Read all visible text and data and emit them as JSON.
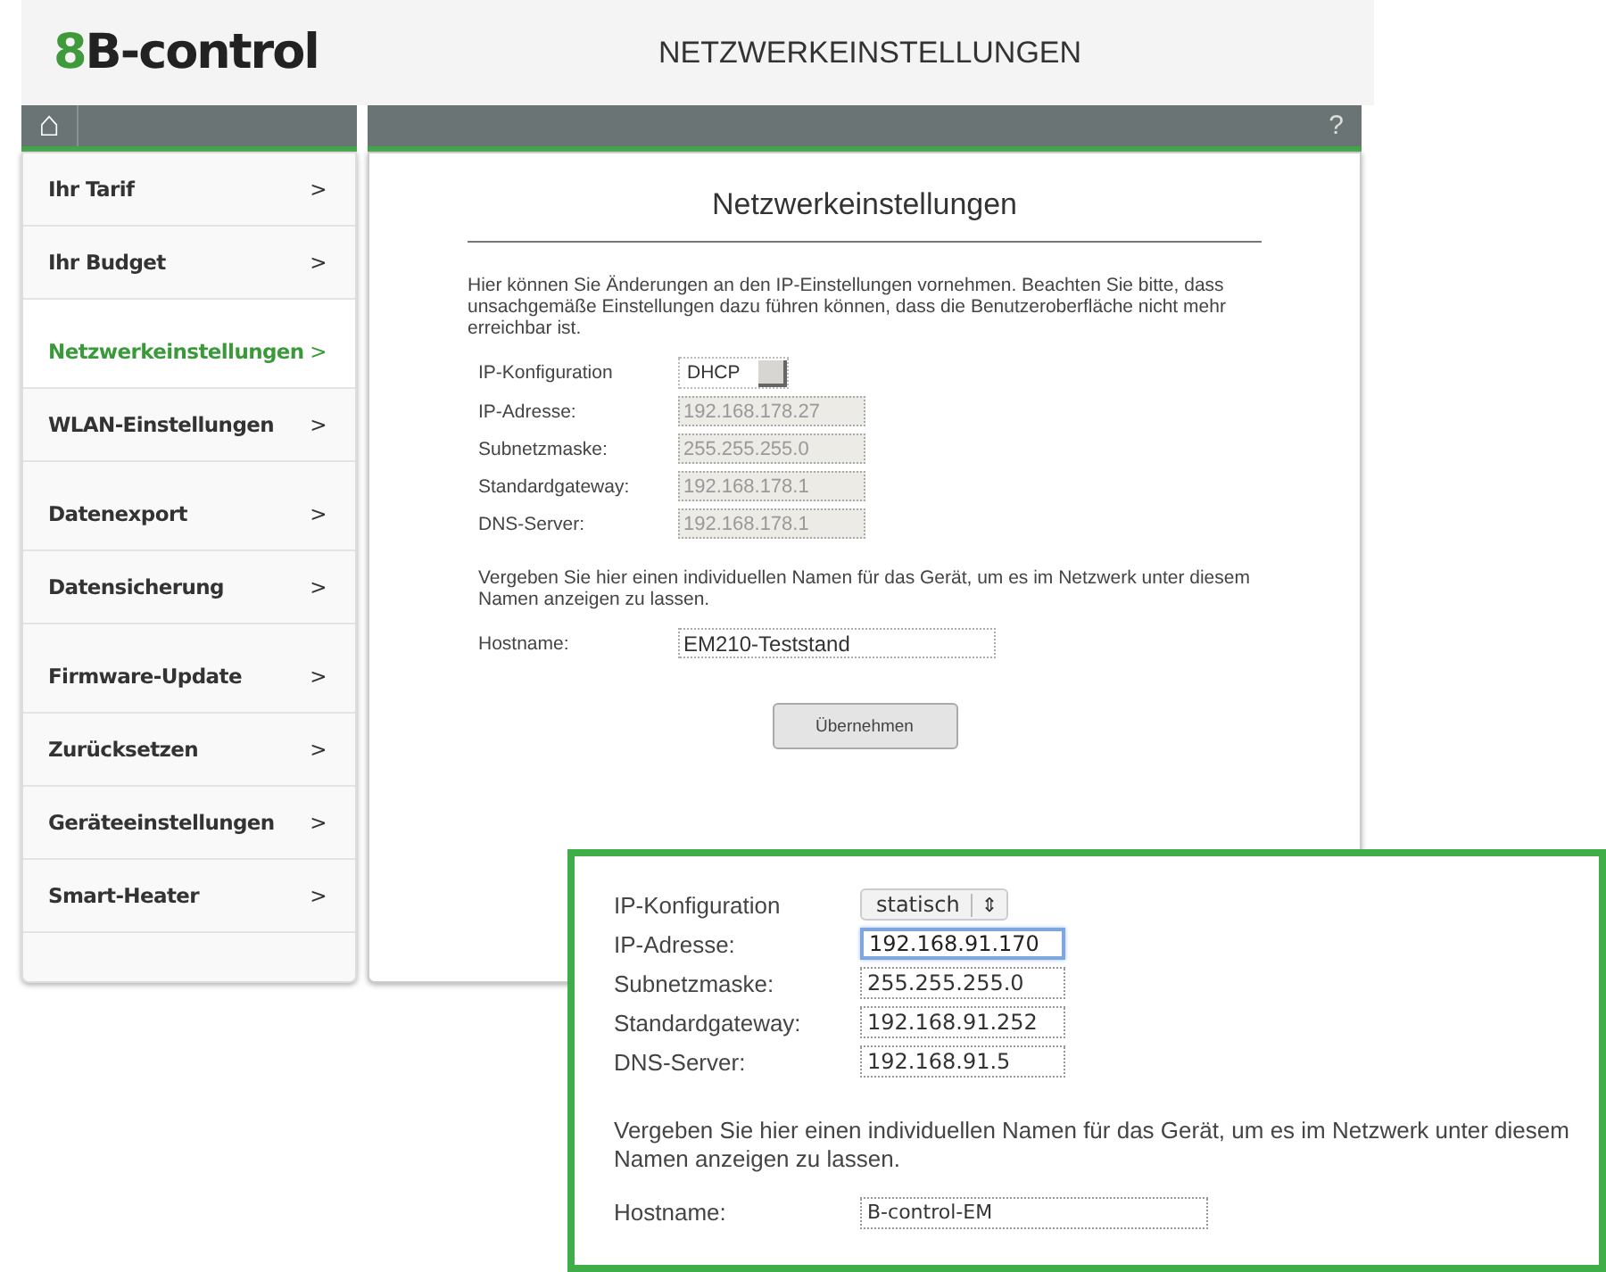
{
  "header": {
    "logo_mark": "8",
    "logo_text": "B-control",
    "title": "NETZWERKEINSTELLUNGEN"
  },
  "toolbar": {
    "home": "⌂",
    "help": "?"
  },
  "sidebar": {
    "items": [
      {
        "label": "Ihr Tarif",
        "selected": false
      },
      {
        "label": "Ihr Budget",
        "selected": false
      },
      {
        "label": "Netzwerkeinstellungen",
        "selected": true
      },
      {
        "label": "WLAN-Einstellungen",
        "selected": false
      },
      {
        "label": "Datenexport",
        "selected": false
      },
      {
        "label": "Datensicherung",
        "selected": false
      },
      {
        "label": "Firmware-Update",
        "selected": false
      },
      {
        "label": "Zurücksetzen",
        "selected": false
      },
      {
        "label": "Geräteeinstellungen",
        "selected": false
      },
      {
        "label": "Smart-Heater",
        "selected": false
      }
    ],
    "chevron": ">"
  },
  "main": {
    "heading": "Netzwerkeinstellungen",
    "intro": "Hier können Sie Änderungen an den IP-Einstellungen vornehmen. Beachten Sie bitte, dass unsachgemäße Einstellungen dazu führen können, dass die Benutzeroberfläche nicht mehr erreichbar ist.",
    "mode": {
      "label": "IP-Konfiguration",
      "value": "DHCP"
    },
    "fields": [
      {
        "label": "IP-Adresse:",
        "value": "192.168.178.27",
        "disabled": true
      },
      {
        "label": "Subnetzmaske:",
        "value": "255.255.255.0",
        "disabled": true
      },
      {
        "label": "Standardgateway:",
        "value": "192.168.178.1",
        "disabled": true
      },
      {
        "label": "DNS-Server:",
        "value": "192.168.178.1",
        "disabled": true
      }
    ],
    "hostname_hint": "Vergeben Sie hier einen individuellen Namen für das Gerät, um es im Netzwerk unter diesem Namen anzeigen zu lassen.",
    "hostname": {
      "label": "Hostname:",
      "value": "EM210-Teststand"
    },
    "apply_button": "Übernehmen"
  },
  "inset": {
    "mode": {
      "label": "IP-Konfiguration",
      "value": "statisch",
      "arrows": "⇕"
    },
    "fields": [
      {
        "label": "IP-Adresse:",
        "value": "192.168.91.170",
        "focused": true
      },
      {
        "label": "Subnetzmaske:",
        "value": "255.255.255.0",
        "focused": false
      },
      {
        "label": "Standardgateway:",
        "value": "192.168.91.252",
        "focused": false
      },
      {
        "label": "DNS-Server:",
        "value": "192.168.91.5",
        "focused": false
      }
    ],
    "hostname_hint": "Vergeben Sie hier einen individuellen Namen für das Gerät, um es im Netzwerk unter diesem Namen anzeigen zu lassen.",
    "hostname": {
      "label": "Hostname:",
      "value": "B-control-EM"
    }
  }
}
